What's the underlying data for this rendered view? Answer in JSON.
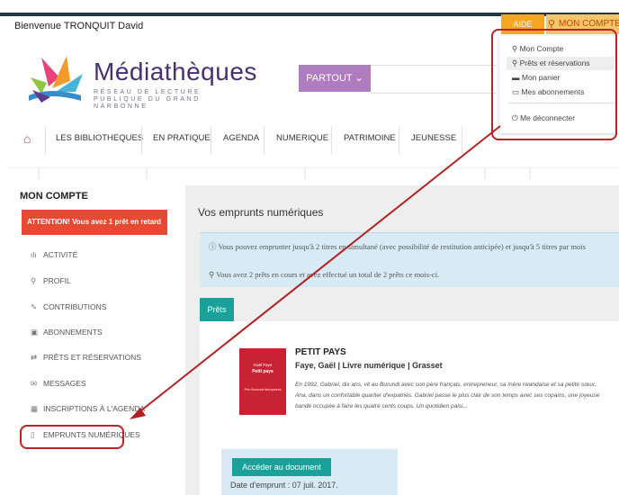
{
  "header": {
    "welcome": "Bienvenue TRONQUIT David",
    "help_label": "AIDE",
    "account_label": "MON COMPTE"
  },
  "brand": {
    "name": "Médiathèques",
    "subtitle": "RÉSEAU DE LECTURE PUBLIQUE DU GRAND NARBONNE"
  },
  "search": {
    "scope_label": "PARTOUT ⌄"
  },
  "account_menu": {
    "items": [
      "Mon Compte",
      "Prêts et réservations",
      "Mon panier",
      "Mes abonnements"
    ],
    "logout": "Me déconnecter"
  },
  "nav": {
    "items": [
      "LES BIBLIOTHEQUES",
      "EN PRATIQUE",
      "AGENDA",
      "NUMERIQUE",
      "PATRIMOINE",
      "JEUNESSE"
    ]
  },
  "sidebar": {
    "title": "MON COMPTE",
    "alert": "ATTENTION! Vous avez 1 prêt en retard",
    "items": [
      "ACTIVITÉ",
      "PROFIL",
      "CONTRIBUTIONS",
      "ABONNEMENTS",
      "PRÊTS ET RÉSERVATIONS",
      "MESSAGES",
      "INSCRIPTIONS À L'AGENDA",
      "EMPRUNTS NUMÉRIQUES"
    ]
  },
  "main": {
    "title": "Vos emprunts numériques",
    "info_line1": "Vous pouvez emprunter jusqu'à 2 titres en simultané (avec possibilité de restitution anticipée) et jusqu'à 5 titres par mois",
    "info_line2": "Vous avez 2 prêts en cours et avez effectué un total de 2 prêts ce mois-ci.",
    "tab_label": "Prêts",
    "book": {
      "cover_author": "Gaël Faye",
      "cover_title": "Petit pays",
      "cover_prize": "Prix Goncourt des lycéens",
      "title": "PETIT PAYS",
      "author_line": "Faye, Gaël | Livre numérique | Grasset",
      "description": "En 1992, Gabriel, dix ans, vit au Burundi avec son père français, entrepreneur, sa mère rwandaise et sa petite sœur, Ana, dans un confortable quartier d'expatriés. Gabriel passe le plus clair de son temps avec ses copains, une joyeuse bande occupée à faire les quatre cents coups. Un quotidien paisi...",
      "access_label": "Accéder au document",
      "loan_date": "Date d'emprunt : 07 juil. 2017."
    }
  },
  "colors": {
    "topbar": "#1f3a44",
    "account_orange": "#f5a623",
    "partout_purple": "#b07cc0",
    "alert_red": "#e64a33",
    "teal": "#1aa19a",
    "highlight_red": "#b22222"
  }
}
